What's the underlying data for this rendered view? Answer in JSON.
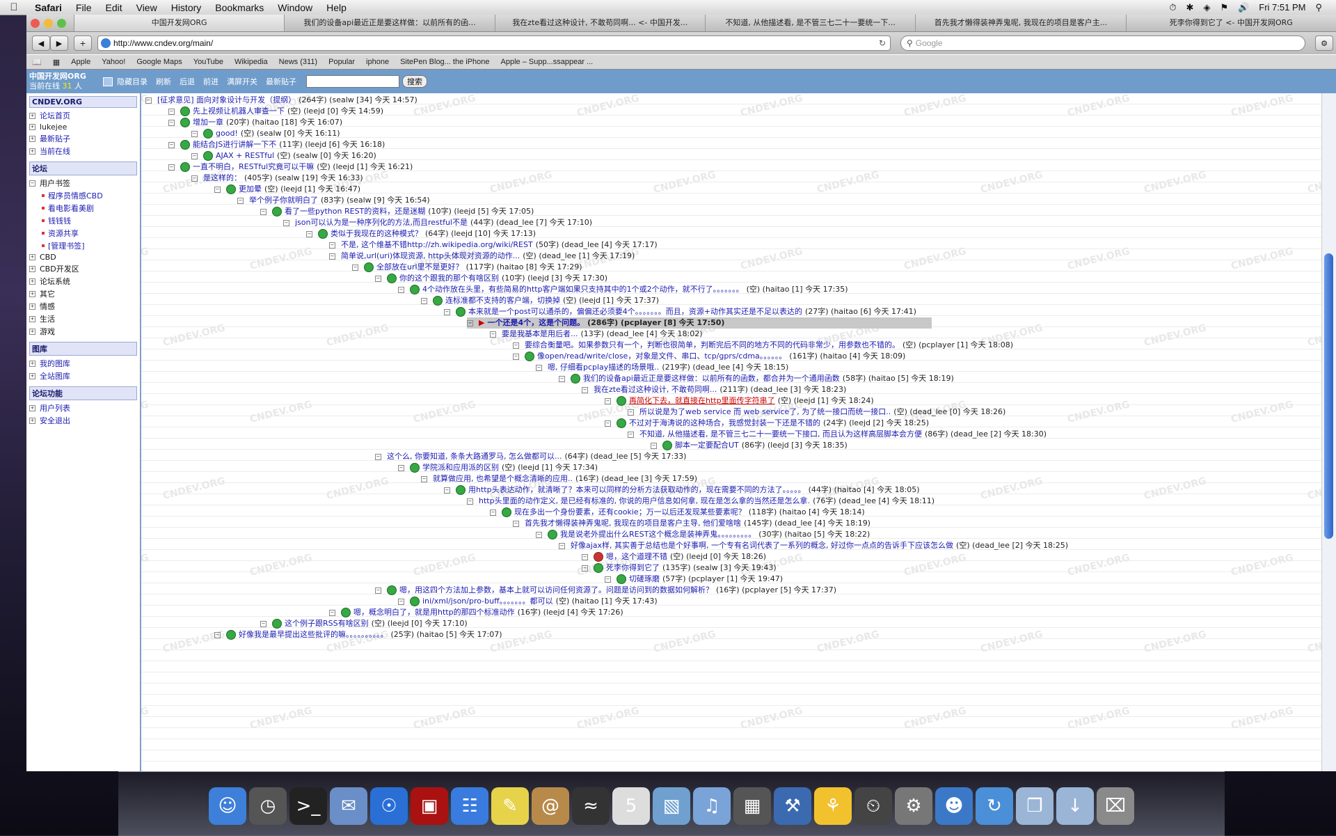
{
  "menubar": {
    "app": "Safari",
    "items": [
      "File",
      "Edit",
      "View",
      "History",
      "Bookmarks",
      "Window",
      "Help"
    ],
    "clock": "Fri 7:51 PM"
  },
  "tabs": [
    "中国开发网ORG",
    "我们的设备api最近正是要这样做：以前所有的函...",
    "我在zte看过这种设计, 不敢苟同啊... <- 中国开发...",
    "不知道, 从他描述看, 是不管三七二十一要统一下...",
    "首先我才懒得装神弄鬼呢, 我现在的项目是客户主...",
    "死李你得到它了 <- 中国开发网ORG"
  ],
  "toolbar": {
    "url": "http://www.cndev.org/main/",
    "search_placeholder": "Google"
  },
  "bookmarks": [
    "Apple",
    "Yahoo!",
    "Google Maps",
    "YouTube",
    "Wikipedia",
    "News (311)",
    "Popular",
    "iphone",
    "SitePen Blog... the iPhone",
    "Apple – Supp...ssappear ..."
  ],
  "site": {
    "brand": "中国开发网ORG",
    "online_prefix": "当前在线",
    "online_count": "31",
    "online_suffix": "人",
    "links": [
      "隐藏目录",
      "刷新",
      "后退",
      "前进",
      "满屏开关",
      "最新贴子"
    ],
    "search_button": "搜索"
  },
  "sidebar": {
    "title": "CNDEV.ORG",
    "top": [
      "论坛首页",
      "lukejee",
      "最新贴子",
      "当前在线"
    ],
    "forum_title": "论坛",
    "forum_bookmarks": "用户书签",
    "bookmark_items": [
      "程序员情感CBD",
      "看电影看美剧",
      "钱钱钱",
      "资源共享",
      "[管理书签]"
    ],
    "forums": [
      "CBD",
      "CBD开发区",
      "论坛系统",
      "其它",
      "情感",
      "生活",
      "游戏"
    ],
    "gallery_title": "图库",
    "gallery": [
      "我的图库",
      "全站图库"
    ],
    "func_title": "论坛功能",
    "func": [
      "用户列表",
      "安全退出"
    ]
  },
  "watermark": "CNDEV.ORG",
  "thread": [
    {
      "d": 0,
      "icon": false,
      "t": "[征求意见] 面向对象设计与开发（提纲）",
      "m": "(264字) (sealw [34] 今天 14:57)"
    },
    {
      "d": 1,
      "icon": true,
      "t": "先上视频让机器人审查一下",
      "m": "(空) (leejd [0] 今天 14:59)"
    },
    {
      "d": 1,
      "icon": true,
      "t": "增加一章",
      "m": "(20字) (haitao [18] 今天 16:07)"
    },
    {
      "d": 2,
      "icon": true,
      "t": "good!",
      "m": "(空) (sealw [0] 今天 16:11)"
    },
    {
      "d": 1,
      "icon": true,
      "t": "能结合JS进行讲解一下不",
      "m": "(11字) (leejd [6] 今天 16:18)"
    },
    {
      "d": 2,
      "icon": true,
      "t": "AJAX + RESTful",
      "m": "(空) (sealw [0] 今天 16:20)"
    },
    {
      "d": 1,
      "icon": true,
      "t": "一直不明白，RESTful究竟可以干嘛",
      "m": "(空) (leejd [1] 今天 16:21)"
    },
    {
      "d": 2,
      "icon": false,
      "t": "是这样的：",
      "m": "(405字) (sealw [19] 今天 16:33)"
    },
    {
      "d": 3,
      "icon": true,
      "t": "更加晕",
      "m": "(空) (leejd [1] 今天 16:47)"
    },
    {
      "d": 4,
      "icon": false,
      "t": "举个例子你就明白了",
      "m": "(83字) (sealw [9] 今天 16:54)"
    },
    {
      "d": 5,
      "icon": true,
      "t": "看了一些python REST的资料，还是迷糊",
      "m": "(10字) (leejd [5] 今天 17:05)"
    },
    {
      "d": 6,
      "icon": false,
      "t": "json可以认为是一种序列化的方法,而且restful不是",
      "m": "(44字) (dead_lee [7] 今天 17:10)"
    },
    {
      "d": 7,
      "icon": true,
      "t": "类似于我现在的这种模式？",
      "m": "(64字) (leejd [10] 今天 17:13)"
    },
    {
      "d": 8,
      "icon": false,
      "t": "不是, 这个维基不错http://zh.wikipedia.org/wiki/REST",
      "m": "(50字) (dead_lee [4] 今天 17:17)"
    },
    {
      "d": 8,
      "icon": false,
      "t": "简单说,url(uri)体现资源, http头体现对资源的动作...",
      "m": "(空) (dead_lee [1] 今天 17:19)"
    },
    {
      "d": 9,
      "icon": true,
      "t": "全部放在url里不是更好？",
      "m": "(117字) (haitao [8] 今天 17:29)"
    },
    {
      "d": 10,
      "icon": true,
      "t": "你的这个跟我的那个有啥区别",
      "m": "(10字) (leejd [3] 今天 17:30)"
    },
    {
      "d": 11,
      "icon": true,
      "t": "4个动作放在头里，有些简易的http客户端如果只支持其中的1个或2个动作，就不行了。。。。。。。",
      "m": "(空) (haitao [1] 今天 17:35)"
    },
    {
      "d": 12,
      "icon": true,
      "t": "连标准都不支持的客户端，切换掉",
      "m": "(空) (leejd [1] 今天 17:37)"
    },
    {
      "d": 13,
      "icon": true,
      "t": "本来就是一个post可以通杀的，偏偏还必须要4个。。。。。。。而且，资源+动作其实还是不足以表达的",
      "m": "(27字) (haitao [6] 今天 17:41)"
    },
    {
      "d": 14,
      "icon": false,
      "cur": true,
      "t": "一个还是4个，这是个问题。",
      "m": "(286字) (pcplayer [8] 今天 17:50)"
    },
    {
      "d": 15,
      "icon": false,
      "t": "要是我基本是用后者...",
      "m": "(13字) (dead_lee [4] 今天 18:02)"
    },
    {
      "d": 16,
      "icon": false,
      "t": "要综合衡量吧。如果参数只有一个，判断也很简单，判断完后不同的地方不同的代码非常少，用参数也不错的。",
      "m": "(空) (pcplayer [1] 今天 18:08)"
    },
    {
      "d": 16,
      "icon": true,
      "t": "像open/read/write/close，对象是文件、串口、tcp/gprs/cdma。。。。。。",
      "m": "(161字) (haitao [4] 今天 18:09)"
    },
    {
      "d": 17,
      "icon": false,
      "t": "嗯, 仔细看pcplay描述的场景哦..",
      "m": "(219字) (dead_lee [4] 今天 18:15)"
    },
    {
      "d": 18,
      "icon": true,
      "t": "我们的设备api最近正是要这样做：以前所有的函数，都合并为一个通用函数",
      "m": "(58字) (haitao [5] 今天 18:19)"
    },
    {
      "d": 19,
      "icon": false,
      "t": "我在zte看过这种设计, 不敢苟同啊...",
      "m": "(211字) (dead_lee [3] 今天 18:23)"
    },
    {
      "d": 20,
      "icon": true,
      "red": true,
      "t": "再简化下去，就直接在http里面传字符串了",
      "m": "(空) (leejd [1] 今天 18:24)"
    },
    {
      "d": 21,
      "icon": false,
      "t": "所以说是为了web service 而 web service了, 为了统一接口而统一接口..",
      "m": "(空) (dead_lee [0] 今天 18:26)"
    },
    {
      "d": 20,
      "icon": true,
      "t": "不过对于海涛说的这种场合，我感觉封装一下还是不错的",
      "m": "(24字) (leejd [2] 今天 18:25)"
    },
    {
      "d": 21,
      "icon": false,
      "t": "不知道, 从他描述看, 是不管三七二十一要统一下接口, 而且认为这样高层脚本会方便",
      "m": "(86字) (dead_lee [2] 今天 18:30)"
    },
    {
      "d": 22,
      "icon": true,
      "t": "脚本一定要配合UT",
      "m": "(86字) (leejd [3] 今天 18:35)"
    },
    {
      "d": 10,
      "icon": false,
      "t": "这个么, 你要知道, 条条大路通罗马, 怎么做都可以...",
      "m": "(64字) (dead_lee [5] 今天 17:33)"
    },
    {
      "d": 11,
      "icon": true,
      "t": "学院派和应用派的区别",
      "m": "(空) (leejd [1] 今天 17:34)"
    },
    {
      "d": 12,
      "icon": false,
      "t": "就算做应用, 也希望是个概念清晰的应用..",
      "m": "(16字) (dead_lee [3] 今天 17:59)"
    },
    {
      "d": 13,
      "icon": true,
      "t": "用http头表达动作，就清晰了？本来可以同样的分析方法获取动作的，现在需要不同的方法了。。。。。",
      "m": "(44字) (haitao [4] 今天 18:05)"
    },
    {
      "d": 14,
      "icon": false,
      "t": "http头里面的动作定义, 是已经有标准的, 你说的用户信息如何拿, 现在是怎么拿的当然还是怎么拿.",
      "m": "(76字) (dead_lee [4] 今天 18:11)"
    },
    {
      "d": 15,
      "icon": true,
      "t": "现在多出一个身份要素，还有cookie；万一以后还发现某些要素呢？",
      "m": "(118字) (haitao [4] 今天 18:14)"
    },
    {
      "d": 16,
      "icon": false,
      "t": "首先我才懒得装神弄鬼呢, 我现在的项目是客户主导, 他们爱啥啥",
      "m": "(145字) (dead_lee [4] 今天 18:19)"
    },
    {
      "d": 17,
      "icon": true,
      "t": "我是说老外提出什么REST这个概念是装神弄鬼。。。。。。。。。",
      "m": "(30字) (haitao [5] 今天 18:22)"
    },
    {
      "d": 18,
      "icon": false,
      "t": "好像ajax样, 其实善于总结也是个好事啊, 一个专有名词代表了一系列的概念, 好过你一点点的告诉手下应该怎么做",
      "m": "(空) (dead_lee [2] 今天 18:25)"
    },
    {
      "d": 19,
      "icon": true,
      "red2": true,
      "t": "嗯，这个道理不错",
      "m": "(空) (leejd [0] 今天 18:26)"
    },
    {
      "d": 19,
      "icon": true,
      "t": "死李你得到它了",
      "m": "(135字) (sealw [3] 今天 19:43)"
    },
    {
      "d": 20,
      "icon": true,
      "t": "切磋琢磨",
      "m": "(57字) (pcplayer [1] 今天 19:47)"
    },
    {
      "d": 10,
      "icon": true,
      "t": "嗯，用这四个方法加上参数，基本上就可以访问任何资源了。问题是访问到的数据如何解析？",
      "m": "(16字) (pcplayer [5] 今天 17:37)"
    },
    {
      "d": 11,
      "icon": true,
      "t": "ini/xml/json/pro-buff。。。。。。。都可以",
      "m": "(空) (haitao [1] 今天 17:43)"
    },
    {
      "d": 8,
      "icon": true,
      "t": "嗯，概念明白了，就是用http的那四个标准动作",
      "m": "(16字) (leejd [4] 今天 17:26)"
    },
    {
      "d": 5,
      "icon": true,
      "t": "这个例子跟RSS有啥区别",
      "m": "(空) (leejd [0] 今天 17:10)"
    },
    {
      "d": 3,
      "icon": true,
      "t": "好像我是最早提出这些批评的嘛。。。。。。。。。。",
      "m": "(25字) (haitao [5] 今天 17:07)"
    }
  ],
  "dock": [
    "Finder",
    "Dashboard",
    "Terminal",
    "Mail",
    "Safari",
    "Photo Booth",
    "iChat",
    "Stickies",
    "Address Book",
    "Activity Monitor",
    "iCal",
    "iPhoto",
    "iTunes",
    "Image Capture",
    "Xcode",
    "Cyberduck",
    "Time Machine",
    "System Preferences",
    "Chat",
    "Sync",
    "Documents",
    "Downloads",
    "Trash"
  ]
}
